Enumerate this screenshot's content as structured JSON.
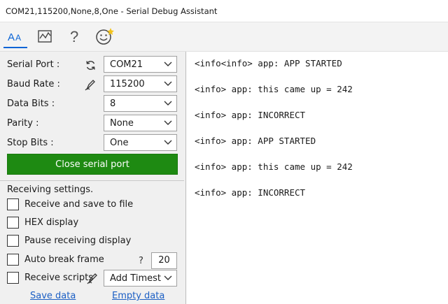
{
  "window": {
    "title": "COM21,115200,None,8,One - Serial Debug Assistant"
  },
  "toolbar": {
    "icons": [
      "font-icon",
      "chart-icon",
      "help-icon",
      "smiley-icon"
    ],
    "accent": "#0a64d6"
  },
  "settings": {
    "serial_port": {
      "label": "Serial Port :",
      "value": "COM21"
    },
    "baud_rate": {
      "label": "Baud Rate :",
      "value": "115200"
    },
    "data_bits": {
      "label": "Data Bits :",
      "value": "8"
    },
    "parity": {
      "label": "Parity :",
      "value": "None"
    },
    "stop_bits": {
      "label": "Stop Bits :",
      "value": "One"
    },
    "close_button": "Close serial port",
    "close_button_color": "#1e8a12"
  },
  "receiving": {
    "label": "Receiving settings.",
    "options": {
      "save_to_file": "Receive and save to file",
      "hex_display": "HEX display",
      "pause_display": "Pause receiving display",
      "auto_break": "Auto break frame",
      "scripts": "Receive scripts"
    },
    "help_mark": "?",
    "break_value": "20",
    "script_select": "Add Timest",
    "save_data": "Save data",
    "empty_data": "Empty data"
  },
  "output": {
    "lines": [
      "<info<info> app: APP STARTED",
      "<info> app: this came up = 242",
      "<info> app: INCORRECT",
      "<info> app: APP STARTED",
      "<info> app: this came up = 242",
      "<info> app: INCORRECT"
    ]
  }
}
